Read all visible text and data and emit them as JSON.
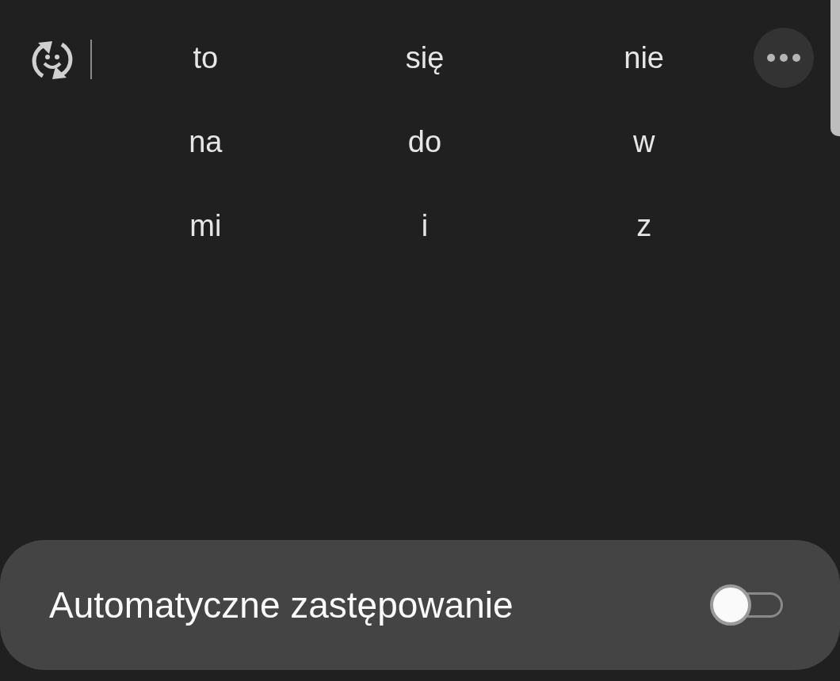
{
  "suggestions": [
    "to",
    "się",
    "nie",
    "na",
    "do",
    "w",
    "mi",
    "i",
    "z"
  ],
  "setting": {
    "label": "Automatyczne zastępowanie",
    "on": false
  }
}
